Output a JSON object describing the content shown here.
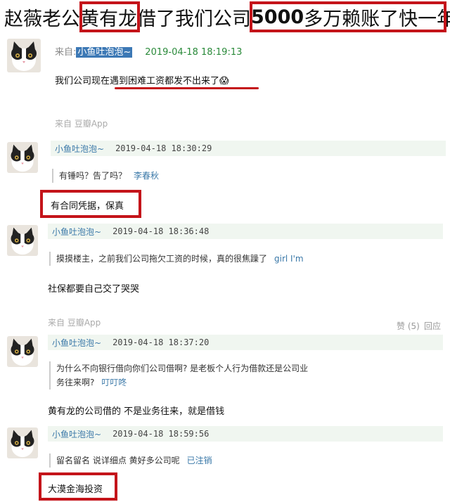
{
  "headline": {
    "part1": "赵薇老公",
    "name": "黄有龙",
    "part2": "借了我们公司",
    "amount": "5000",
    "part3": "多万赖账了快一年"
  },
  "main_post": {
    "from_prefix": "来自:",
    "user": "小鱼吐泡泡~",
    "time": "2019-04-18 18:19:13",
    "text_pre": "我们公司现在遇到",
    "text_underlined": "困难工资都发不出来了",
    "emoji": "😱",
    "source": "来自 豆瓣App"
  },
  "replies": [
    {
      "user": "小鱼吐泡泡~",
      "time": "2019-04-18 18:30:29",
      "quote": "有锤吗？告了吗？",
      "quote_author": "李春秋",
      "text": "有合同凭据，保真"
    },
    {
      "user": "小鱼吐泡泡~",
      "time": "2019-04-18 18:36:48",
      "quote": "摸摸楼主，之前我们公司拖欠工资的时候，真的很焦躁了",
      "quote_author": "girl I'm",
      "text": "社保都要自己交了哭哭",
      "source": "来自 豆瓣App",
      "likes": "赞 (5)",
      "reply": "回应"
    },
    {
      "user": "小鱼吐泡泡~",
      "time": "2019-04-18 18:37:20",
      "quote_line1": "为什么不向银行借向你们公司借啊? 是老板个人行为借款还是公司业",
      "quote_line2": "务往来啊?",
      "quote_author": "叮叮咚",
      "text": "黄有龙的公司借的 不是业务往来，就是借钱"
    },
    {
      "user": "小鱼吐泡泡~",
      "time": "2019-04-18 18:59:56",
      "quote": "留名留名 说详细点 黄好多公司呢",
      "quote_author": "已注销",
      "text": "大漠金海投资"
    }
  ],
  "colors": {
    "highlight_red": "#c4141a",
    "link_blue": "#3a78a8",
    "time_green": "#2a8a3a",
    "meta_bg": "#f0f6f0"
  }
}
